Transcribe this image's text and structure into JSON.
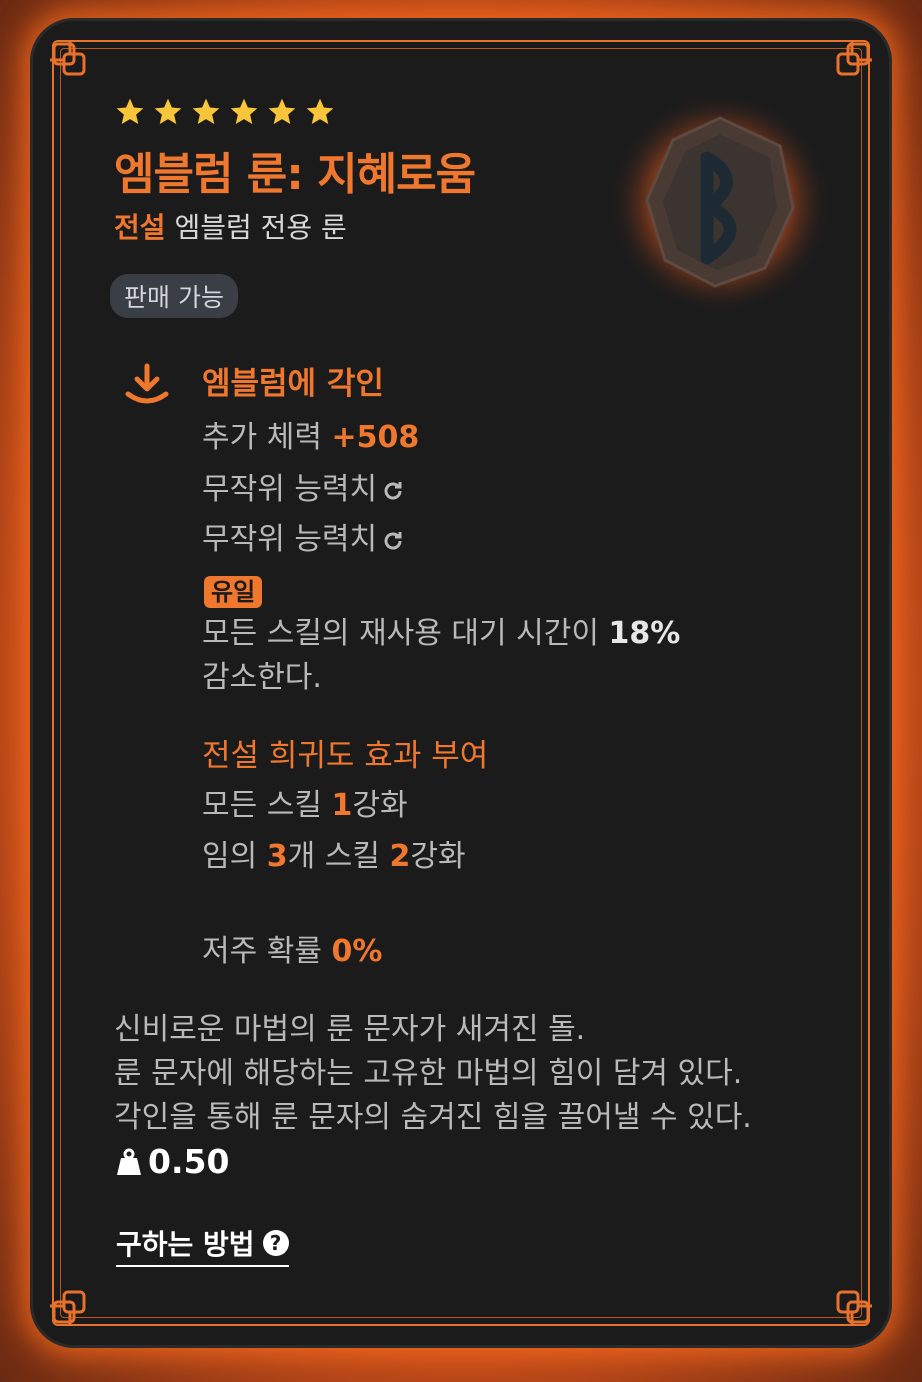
{
  "item": {
    "star_count": 6,
    "title": "엠블럼 룬: 지혜로움",
    "grade": "전설",
    "type": "엠블럼 전용 룬",
    "sell_badge": "판매 가능"
  },
  "engrave": {
    "section_title": "엠블럼에 각인",
    "bonus_label": "추가 체력 ",
    "bonus_value": "+508",
    "random_stat_1": "무작위 능력치",
    "random_stat_2": "무작위 능력치",
    "unique_badge": "유일",
    "unique_line1_text": "모든 스킬의 재사용 대기 시간이 ",
    "unique_line1_value": "18%",
    "unique_line2": "감소한다."
  },
  "legendary": {
    "section_title": "전설 희귀도 효과 부여",
    "line1_pre": "모든 스킬 ",
    "line1_value": "1",
    "line1_post": "강화",
    "line2_pre": "임의 ",
    "line2_value1": "3",
    "line2_mid": "개 스킬 ",
    "line2_value2": "2",
    "line2_post": "강화"
  },
  "curse": {
    "label": "저주 확률 ",
    "value": "0%"
  },
  "description": [
    "신비로운 마법의 룬 문자가 새겨진 돌.",
    "룬 문자에 해당하는 고유한 마법의 힘이 담겨 있다.",
    "각인을 통해 룬 문자의 숨겨진 힘을 끌어낼 수 있다."
  ],
  "weight": "0.50",
  "how_to_get": "구하는 방법",
  "colors": {
    "accent": "#f0772e",
    "card_bg": "#1b1b1c",
    "star": "#f9c53a"
  },
  "icons": [
    "star-icon",
    "rune-icon",
    "engrave-icon",
    "reroll-icon",
    "weight-icon",
    "help-icon"
  ]
}
